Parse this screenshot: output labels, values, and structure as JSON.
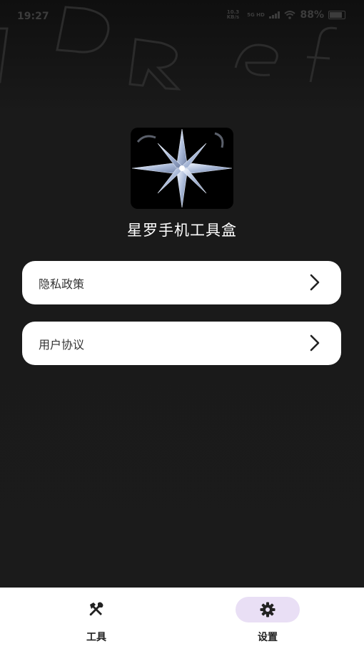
{
  "status_bar": {
    "time": "19:27",
    "net_speed_value": "10.3",
    "net_speed_unit": "KB/s",
    "network_type": "5G HD",
    "battery_percent": "88%"
  },
  "app": {
    "name": "星罗手机工具盒",
    "logo_icon": "compass-star-icon"
  },
  "menu": {
    "items": [
      {
        "label": "隐私政策",
        "icon": "chevron-right-icon"
      },
      {
        "label": "用户协议",
        "icon": "chevron-right-icon"
      }
    ]
  },
  "tabs": [
    {
      "label": "工具",
      "icon": "tools-icon",
      "selected": false
    },
    {
      "label": "设置",
      "icon": "gear-icon",
      "selected": true
    }
  ],
  "colors": {
    "background": "#1b1b1b",
    "card": "#ffffff",
    "selected_tab_pill": "#e9dff5"
  }
}
